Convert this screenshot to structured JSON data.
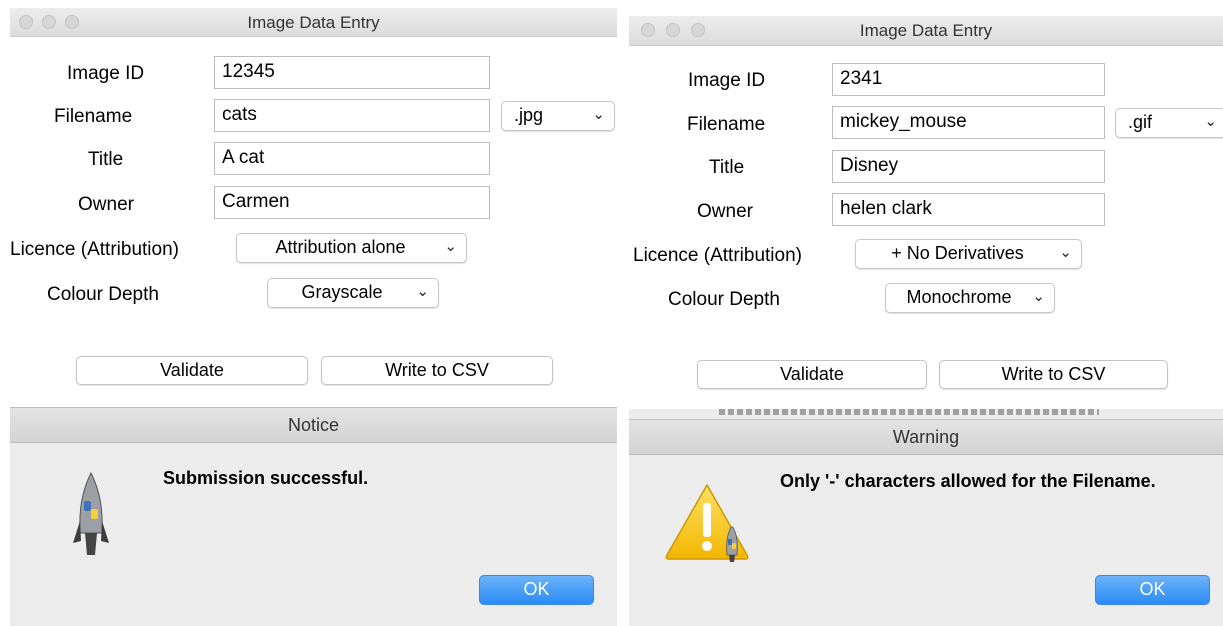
{
  "left": {
    "window_title": "Image Data Entry",
    "fields": {
      "image_id": {
        "label": "Image ID",
        "value": "12345"
      },
      "filename": {
        "label": "Filename",
        "value": "cats"
      },
      "title": {
        "label": "Title",
        "value": "A cat"
      },
      "owner": {
        "label": "Owner",
        "value": "Carmen"
      }
    },
    "extension": ".jpg",
    "licence": {
      "label": "Licence (Attribution)",
      "value": "Attribution alone"
    },
    "colour_depth": {
      "label": "Colour Depth",
      "value": "Grayscale"
    },
    "buttons": {
      "validate": "Validate",
      "write_csv": "Write to CSV"
    },
    "dialog": {
      "title": "Notice",
      "message": "Submission successful.",
      "icon": "python-rocket-icon",
      "ok": "OK"
    }
  },
  "right": {
    "window_title": "Image Data Entry",
    "fields": {
      "image_id": {
        "label": "Image ID",
        "value": "2341"
      },
      "filename": {
        "label": "Filename",
        "value": "mickey_mouse"
      },
      "title": {
        "label": "Title",
        "value": "Disney"
      },
      "owner": {
        "label": "Owner",
        "value": "helen clark"
      }
    },
    "extension": ".gif",
    "licence": {
      "label": "Licence (Attribution)",
      "value": "+ No Derivatives"
    },
    "colour_depth": {
      "label": "Colour Depth",
      "value": "Monochrome"
    },
    "buttons": {
      "validate": "Validate",
      "write_csv": "Write to CSV"
    },
    "dialog": {
      "title": "Warning",
      "message": "Only '-' characters allowed for the Filename.",
      "icon": "warning-icon",
      "ok": "OK"
    }
  },
  "colors": {
    "titlebar": "#dcdcdc",
    "dialog_bg": "#ececec",
    "ok_button": "#2a8cf5",
    "warning_yellow": "#f5c800"
  }
}
